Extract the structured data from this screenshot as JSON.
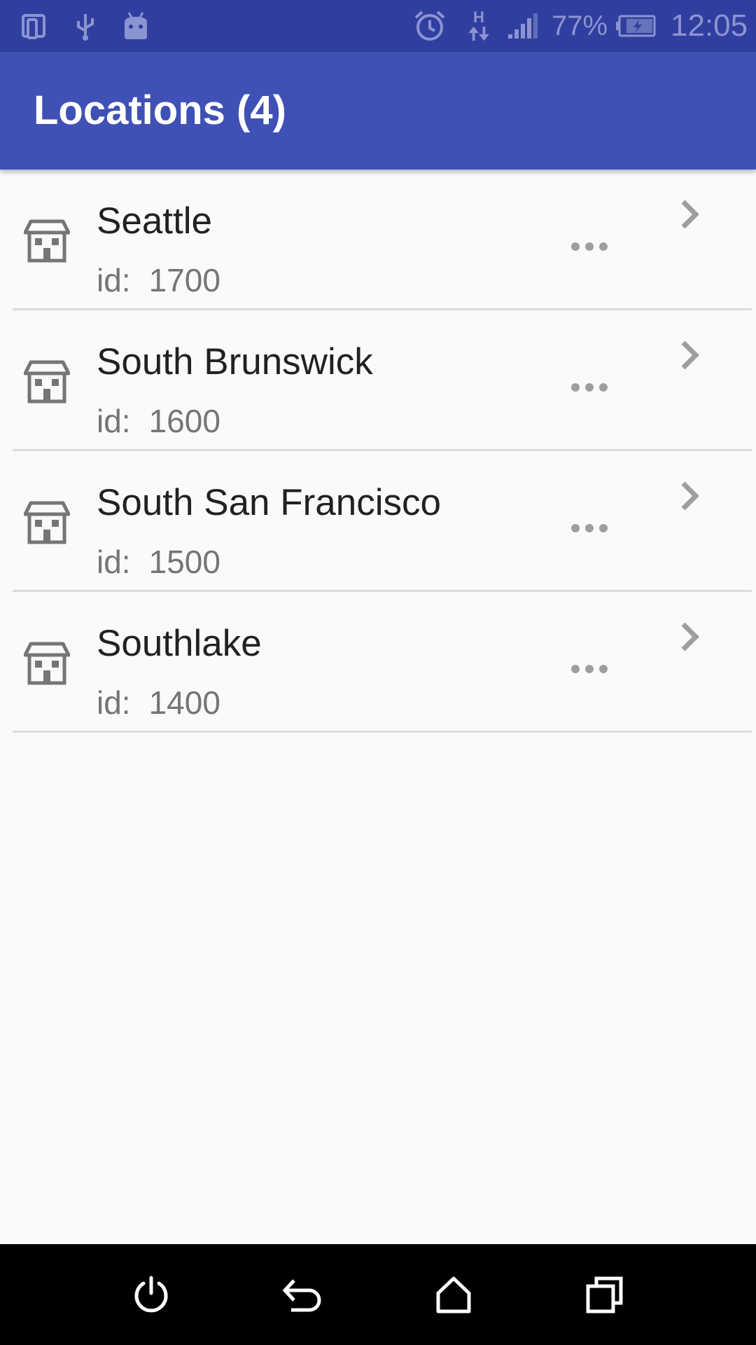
{
  "status_bar": {
    "battery_percent": "77%",
    "time": "12:05",
    "network_type": "H",
    "icons": [
      "phone-tablet-icon",
      "usb-icon",
      "android-debug-icon",
      "alarm-icon",
      "data-arrows-icon",
      "signal-icon",
      "battery-charging-icon"
    ]
  },
  "app_bar": {
    "title": "Locations (4)"
  },
  "locations": [
    {
      "name": "Seattle",
      "id_label": "id:",
      "id": "1700"
    },
    {
      "name": "South Brunswick",
      "id_label": "id:",
      "id": "1600"
    },
    {
      "name": "South San Francisco",
      "id_label": "id:",
      "id": "1500"
    },
    {
      "name": "Southlake",
      "id_label": "id:",
      "id": "1400"
    }
  ],
  "nav_bar": {
    "buttons": [
      "power-icon",
      "back-icon",
      "home-icon",
      "recents-icon"
    ]
  },
  "colors": {
    "status_bar": "#303f9f",
    "app_bar": "#3f51b5",
    "background": "#fafafa",
    "icon_gray": "#757575"
  }
}
